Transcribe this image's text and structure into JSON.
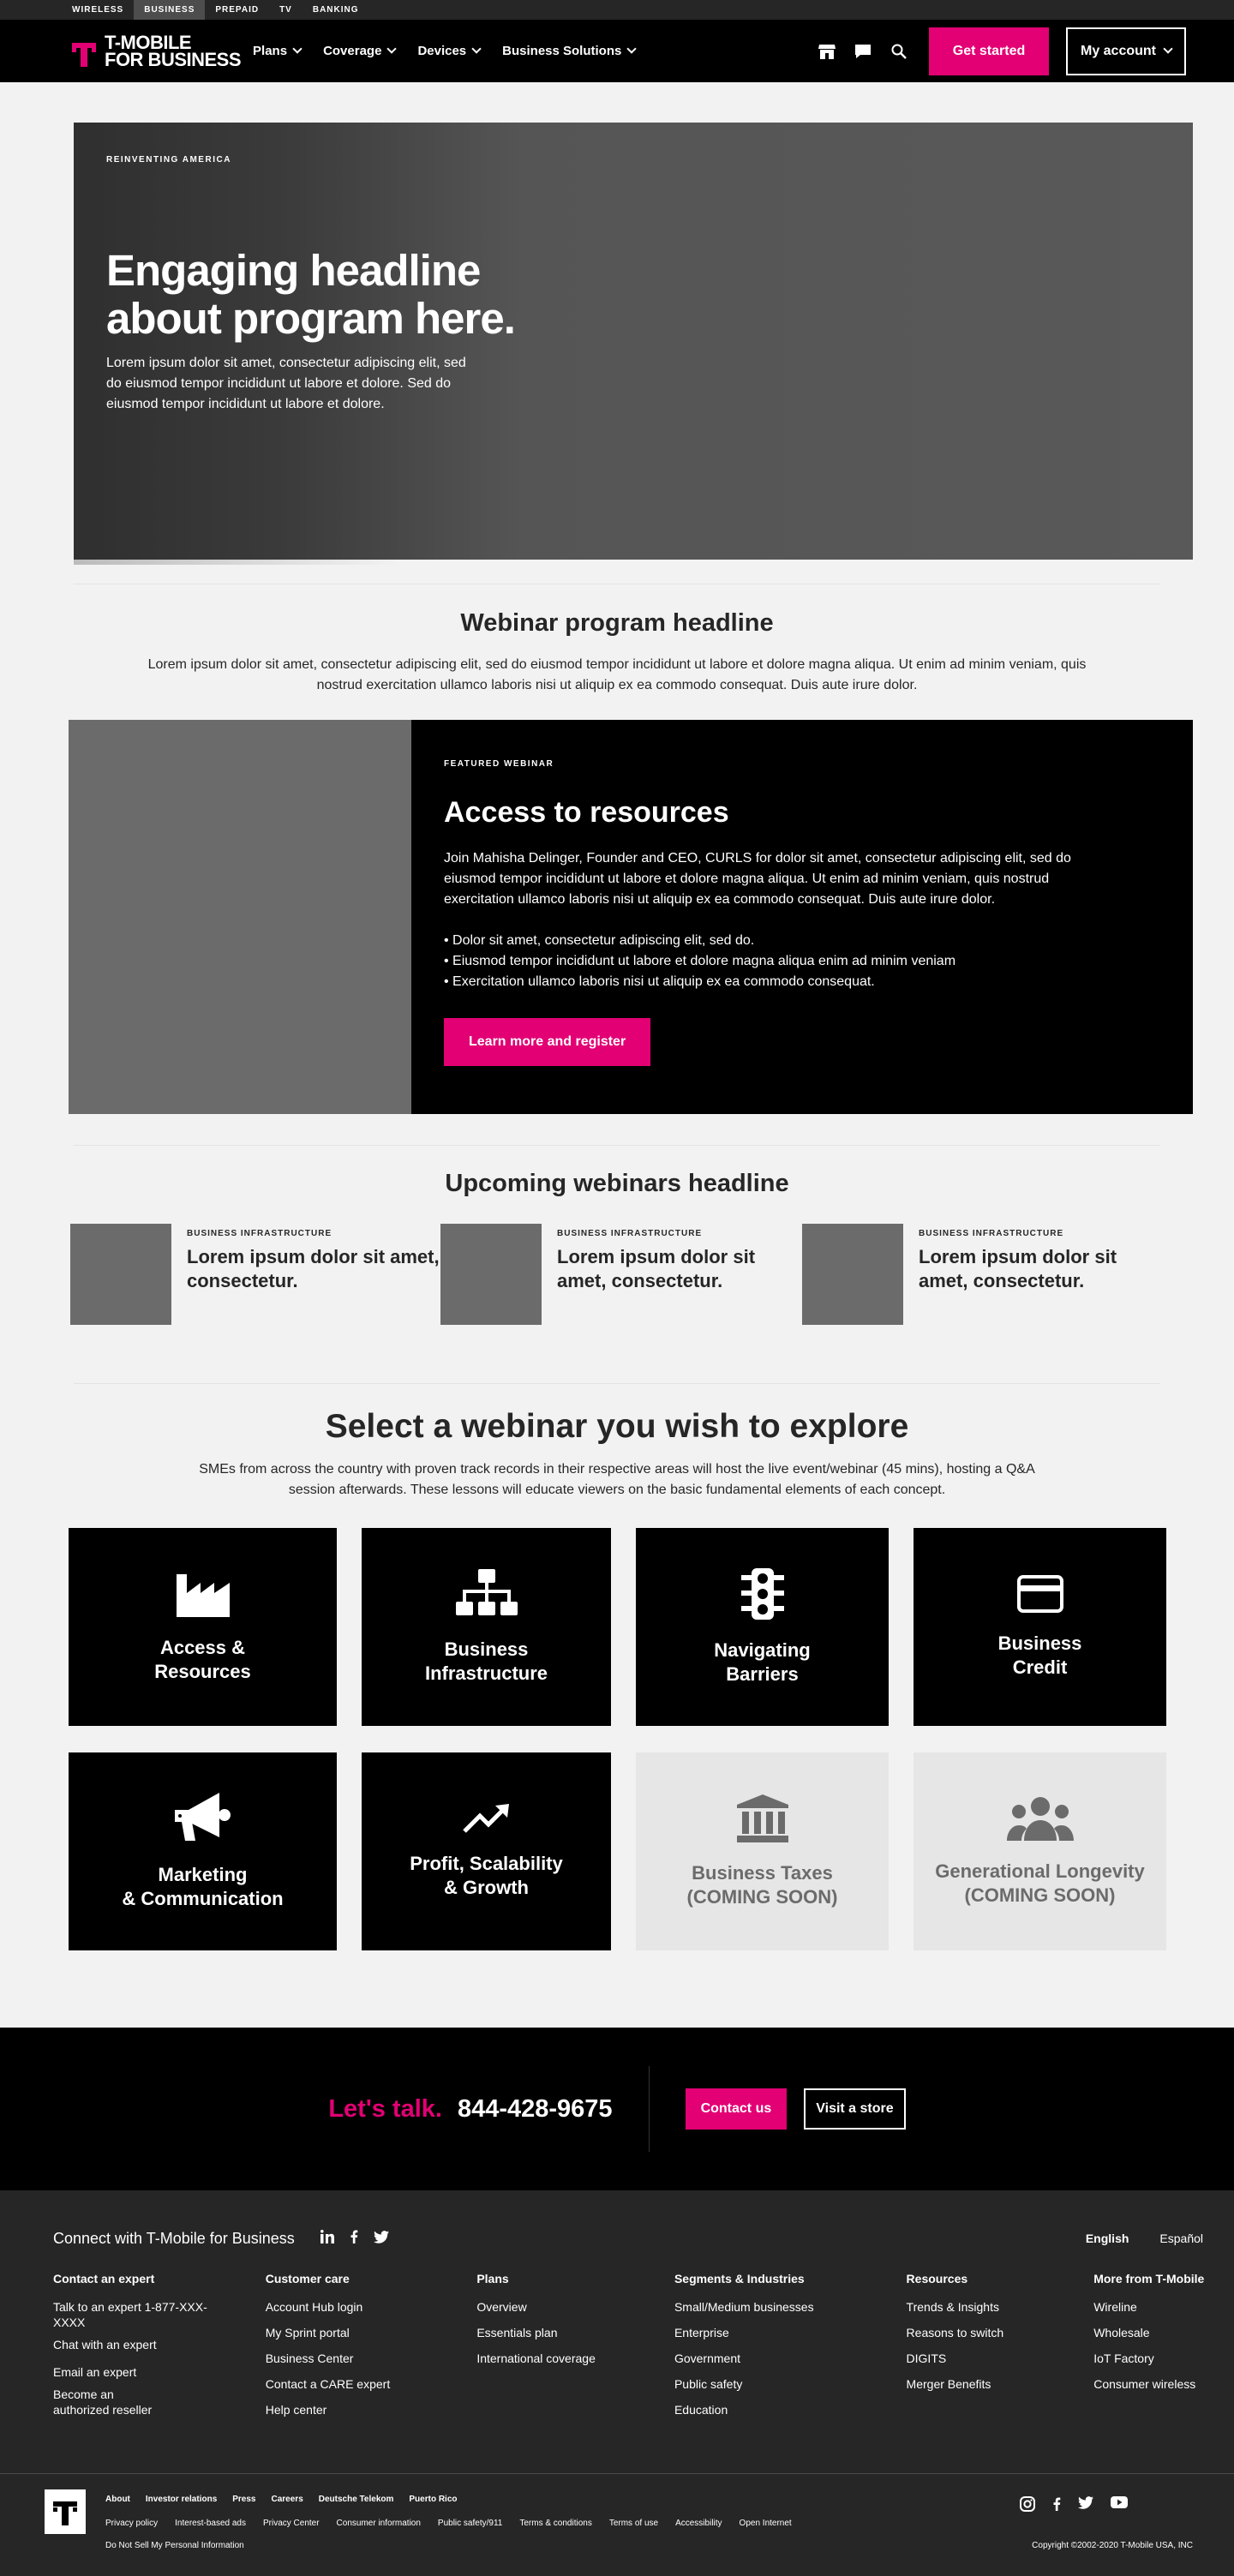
{
  "topbar": {
    "items": [
      "WIRELESS",
      "BUSINESS",
      "PREPAID",
      "TV",
      "BANKING"
    ]
  },
  "nav": {
    "logo_line1": "T-MOBILE",
    "logo_line2": "FOR BUSINESS",
    "menu": [
      "Plans",
      "Coverage",
      "Devices",
      "Business Solutions"
    ],
    "get_started": "Get started",
    "my_account": "My account"
  },
  "hero": {
    "eyebrow": "REINVENTING AMERICA",
    "headline": "Engaging headline about program here.",
    "body": "Lorem ipsum dolor sit amet, consectetur adipiscing elit, sed do eiusmod tempor incididunt ut labore et dolore. Sed do eiusmod tempor incididunt ut labore et dolore."
  },
  "program": {
    "headline": "Webinar program headline",
    "body": "Lorem ipsum dolor sit amet, consectetur adipiscing elit, sed do eiusmod tempor incididunt ut labore et dolore magna aliqua. Ut enim ad minim veniam, quis nostrud exercitation ullamco laboris nisi ut aliquip ex ea commodo consequat. Duis aute irure dolor."
  },
  "featured": {
    "eyebrow": "FEATURED WEBINAR",
    "headline": "Access to resources",
    "body": "Join Mahisha Delinger, Founder and CEO, CURLS for dolor sit amet, consectetur adipiscing elit, sed do eiusmod tempor incididunt ut labore et dolore magna aliqua. Ut enim ad minim veniam, quis nostrud exercitation ullamco laboris nisi ut aliquip ex ea commodo consequat. Duis aute irure dolor.",
    "bullets": [
      "• Dolor sit amet, consectetur adipiscing elit, sed do.",
      "• Eiusmod tempor incididunt ut labore et dolore magna aliqua enim ad minim veniam",
      "• Exercitation ullamco laboris nisi ut aliquip ex ea commodo consequat."
    ],
    "cta": "Learn more and register"
  },
  "upcoming": {
    "headline": "Upcoming webinars headline",
    "items": [
      {
        "tag": "BUSINESS INFRASTRUCTURE",
        "title": "Lorem ipsum dolor sit amet, consectetur."
      },
      {
        "tag": "BUSINESS INFRASTRUCTURE",
        "title": "Lorem ipsum dolor sit amet, consectetur."
      },
      {
        "tag": "BUSINESS INFRASTRUCTURE",
        "title": "Lorem ipsum dolor sit amet, consectetur."
      }
    ]
  },
  "select": {
    "headline": "Select a webinar you wish to explore",
    "body": "SMEs from across the country with proven track records in their respective areas will host the live event/webinar (45 mins), hosting a Q&A session afterwards. These lessons will educate viewers on the basic fundamental elements of each concept.",
    "cards": [
      {
        "line1": "Access &",
        "line2": "Resources",
        "icon": "factory-icon",
        "soon": false
      },
      {
        "line1": "Business",
        "line2": "Infrastructure",
        "icon": "org-chart-icon",
        "soon": false
      },
      {
        "line1": "Navigating",
        "line2": "Barriers",
        "icon": "traffic-light-icon",
        "soon": false
      },
      {
        "line1": "Business",
        "line2": "Credit",
        "icon": "credit-card-icon",
        "soon": false
      },
      {
        "line1": "Marketing",
        "line2": "& Communication",
        "icon": "megaphone-icon",
        "soon": false
      },
      {
        "line1": "Profit, Scalability",
        "line2": "& Growth",
        "icon": "trend-up-icon",
        "soon": false
      },
      {
        "line1": "Business Taxes",
        "line2": "(COMING SOON)",
        "icon": "bank-icon",
        "soon": true
      },
      {
        "line1": "Generational Longevity",
        "line2": "(COMING SOON)",
        "icon": "people-icon",
        "soon": true
      }
    ]
  },
  "talk": {
    "lets_talk": "Let's talk.",
    "phone": "844-428-9675",
    "contact": "Contact us",
    "store": "Visit a store"
  },
  "footer": {
    "connect": "Connect with T-Mobile for Business",
    "lang_en": "English",
    "lang_es": "Español",
    "columns": [
      {
        "title": "Contact an expert",
        "links": [
          "Talk to an expert 1-877-XXX-XXXX",
          "Chat with an expert",
          "Email an expert",
          "Become an authorized reseller"
        ]
      },
      {
        "title": "Customer care",
        "links": [
          "Account Hub login",
          "My Sprint portal",
          "Business Center",
          "Contact a CARE expert",
          "Help center"
        ]
      },
      {
        "title": "Plans",
        "links": [
          "Overview",
          "Essentials plan",
          "International coverage"
        ]
      },
      {
        "title": "Segments & Industries",
        "links": [
          "Small/Medium businesses",
          "Enterprise",
          "Government",
          "Public safety",
          "Education"
        ]
      },
      {
        "title": "Resources",
        "links": [
          "Trends & Insights",
          "Reasons to switch",
          "DIGITS",
          "Merger Benefits"
        ]
      },
      {
        "title": "More from T-Mobile",
        "links": [
          "Wireline",
          "Wholesale",
          "IoT Factory",
          "Consumer wireless"
        ]
      }
    ]
  },
  "legal": {
    "row1": [
      "About",
      "Investor relations",
      "Press",
      "Careers",
      "Deutsche Telekom",
      "Puerto Rico"
    ],
    "row2": [
      "Privacy policy",
      "Interest-based ads",
      "Privacy Center",
      "Consumer information",
      "Public safety/911",
      "Terms & conditions",
      "Terms of use",
      "Accessibility",
      "Open Internet"
    ],
    "row3": "Do Not Sell My Personal Information",
    "copyright": "Copyright ©2002-2020 T-Mobile USA, INC"
  },
  "colors": {
    "magenta": "#e20074",
    "black": "#000000",
    "gray_bg": "#f2f2f2",
    "dark_footer": "#262626"
  }
}
